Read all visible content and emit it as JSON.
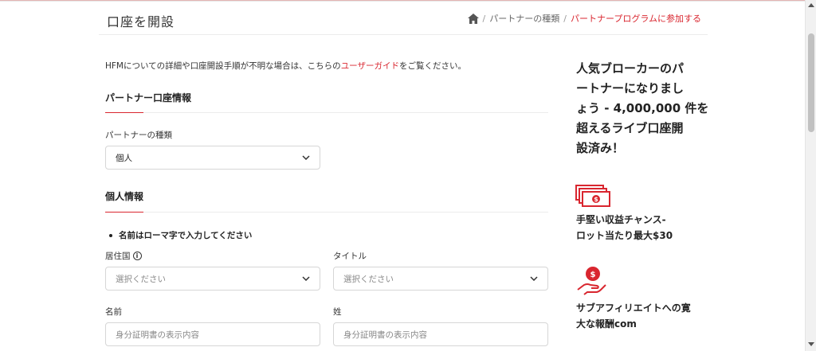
{
  "header": {
    "title": "口座を開設",
    "breadcrumb": {
      "home_icon": "home-icon",
      "item1": "パートナーの種類",
      "separator": "/",
      "item2": "パートナープログラムに参加する"
    }
  },
  "intro": {
    "prefix": "HFMについての詳細や口座開設手順が不明な場合は、こちらの",
    "link": "ユーザーガイド",
    "suffix": "をご覧ください。"
  },
  "partner_section": {
    "title": "パートナー口座情報",
    "type_label": "パートナーの種類",
    "type_value": "個人"
  },
  "personal_section": {
    "title": "個人情報",
    "note": "名前はローマ字で入力してください",
    "country_label": "居住国",
    "country_placeholder": "選択ください",
    "title_label": "タイトル",
    "title_placeholder": "選択ください",
    "first_name_label": "名前",
    "first_name_placeholder": "身分証明書の表示内容",
    "last_name_label": "姓",
    "last_name_placeholder": "身分証明書の表示内容"
  },
  "sidebar": {
    "heading_line1": "人気ブローカーのパ",
    "heading_line2": "ートナーになりまし",
    "heading_line3": "ょう - 4,000,000 件を",
    "heading_line4": "超えるライブ口座開",
    "heading_line5": "設済み！",
    "benefit1": {
      "icon": "money-icon",
      "line1": "手堅い収益チャンス-",
      "line2": "ロット当たり最大$30"
    },
    "benefit2": {
      "icon": "hand-coin-icon",
      "line1": "サブアフィリエイトへの寛",
      "line2": "大な報酬com"
    }
  },
  "colors": {
    "accent": "#d9262f",
    "border": "#d6d6d6",
    "text": "#222222"
  }
}
